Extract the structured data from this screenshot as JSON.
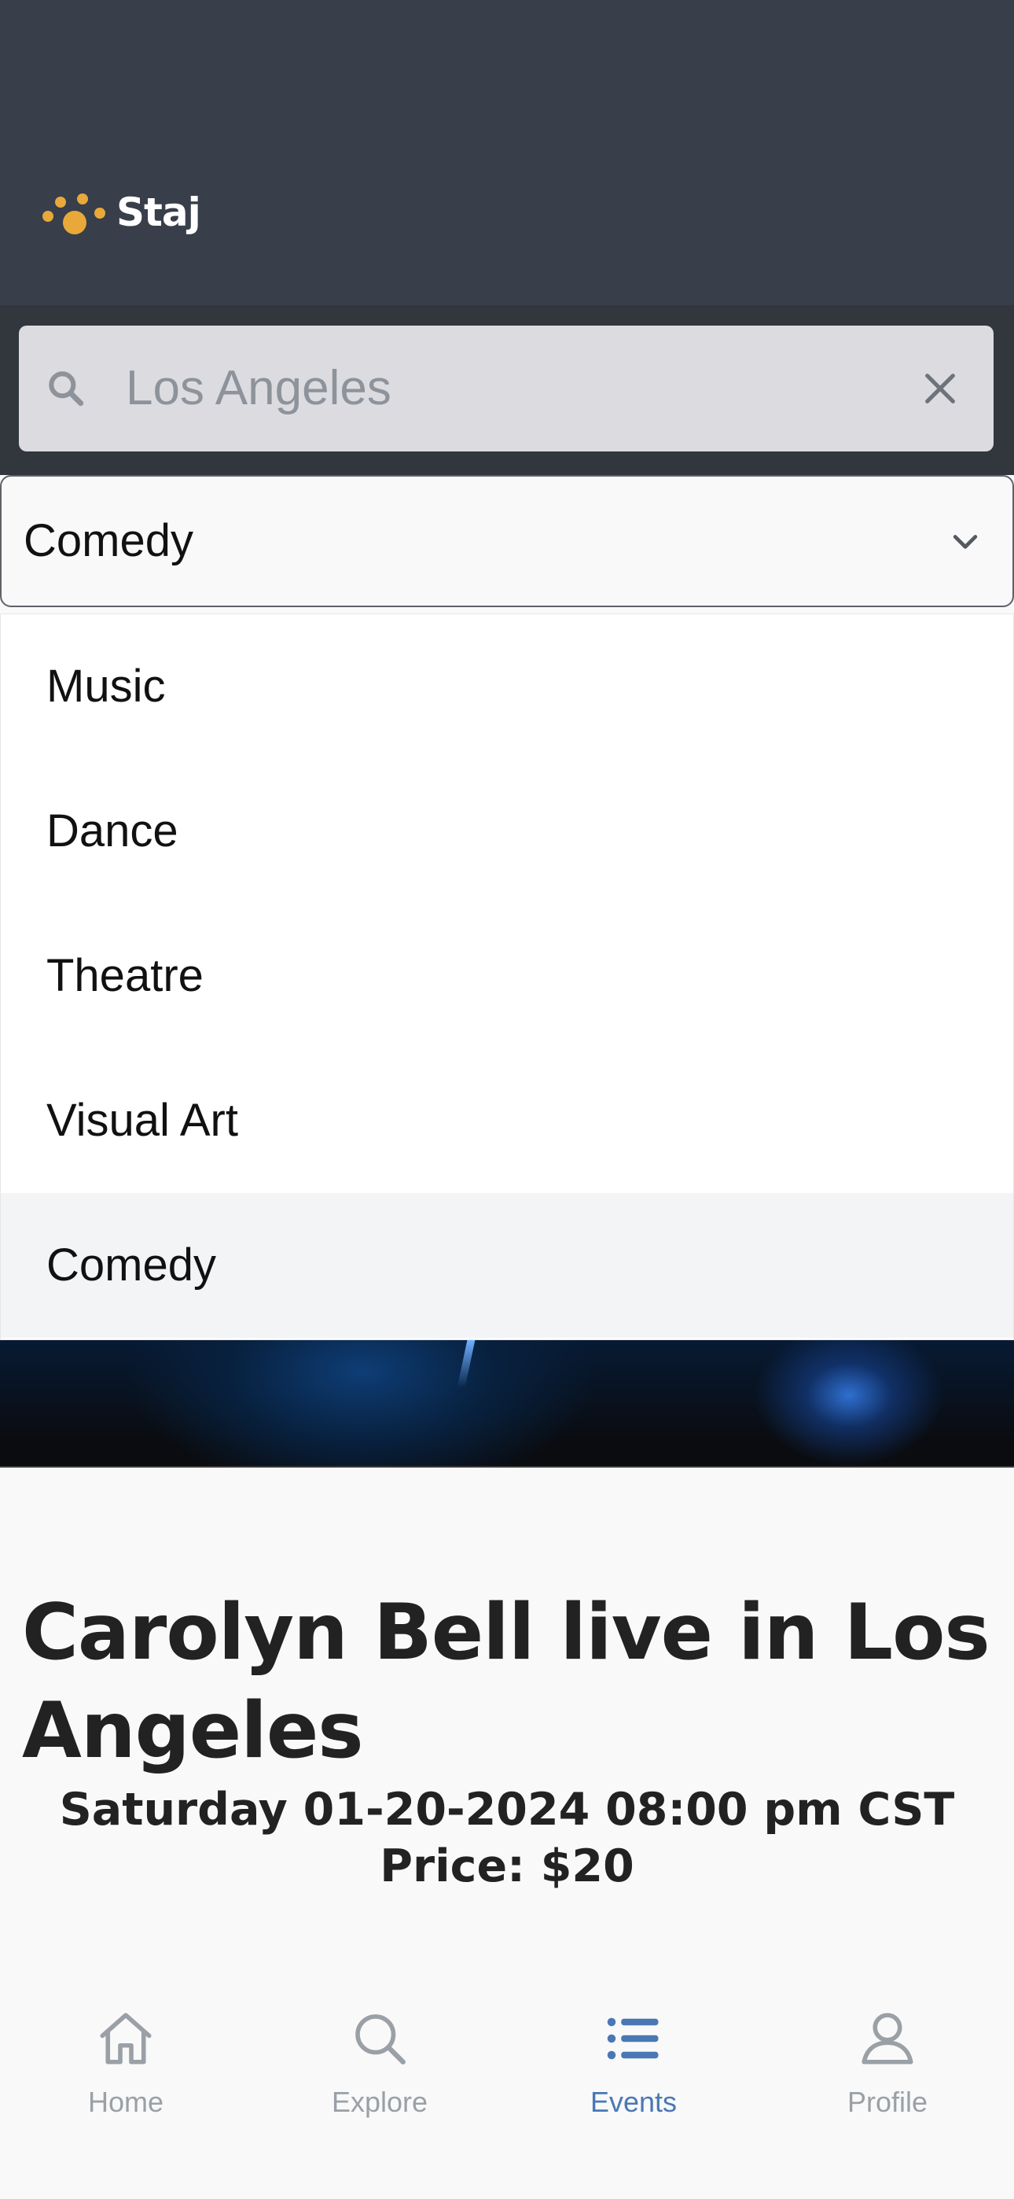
{
  "app": {
    "name": "Staj"
  },
  "search": {
    "value": "Los Angeles"
  },
  "category_select": {
    "selected": "Comedy",
    "options": [
      "Music",
      "Dance",
      "Theatre",
      "Visual Art",
      "Comedy"
    ]
  },
  "event": {
    "title": "Carolyn Bell live in Los Angeles",
    "date": "Saturday 01-20-2024 08:00 pm CST",
    "price": "Price: $20"
  },
  "tabbar": {
    "items": [
      {
        "label": "Home",
        "icon": "home-icon"
      },
      {
        "label": "Explore",
        "icon": "search-icon"
      },
      {
        "label": "Events",
        "icon": "list-icon"
      },
      {
        "label": "Profile",
        "icon": "user-icon"
      }
    ],
    "active": "Events"
  },
  "colors": {
    "header": "#383e4a",
    "accent": "#4a78b5",
    "logo": "#e8a93a"
  }
}
